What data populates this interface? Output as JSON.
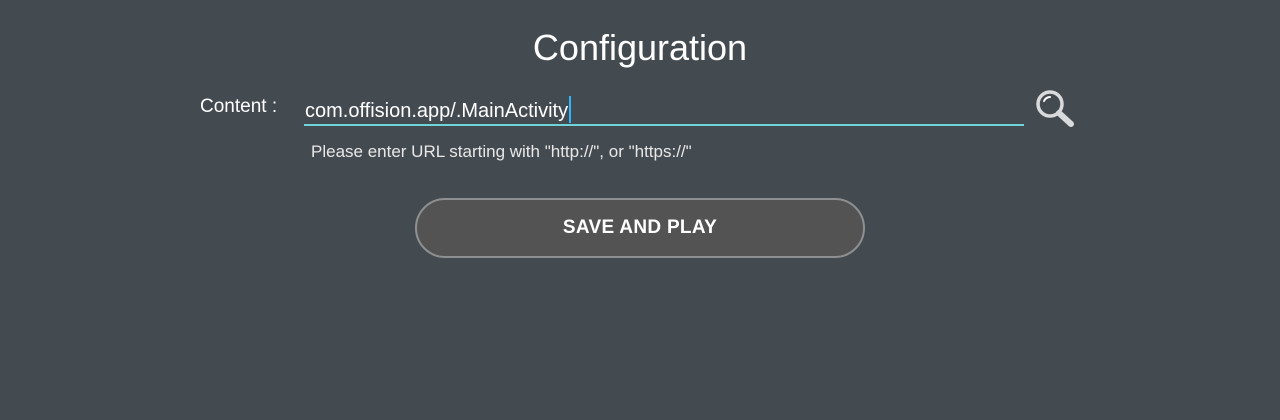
{
  "page": {
    "title": "Configuration"
  },
  "form": {
    "content_label": "Content :",
    "content_value": "com.offision.app/.MainActivity",
    "hint": "Please enter URL starting with \"http://\", or \"https://\"",
    "search_icon": "search-icon",
    "save_label": "SAVE AND PLAY"
  },
  "colors": {
    "background": "#434a50",
    "underline": "#6fd3d7",
    "caret": "#2db7ff",
    "button_fill": "#535353",
    "button_border": "#8e8f90"
  }
}
